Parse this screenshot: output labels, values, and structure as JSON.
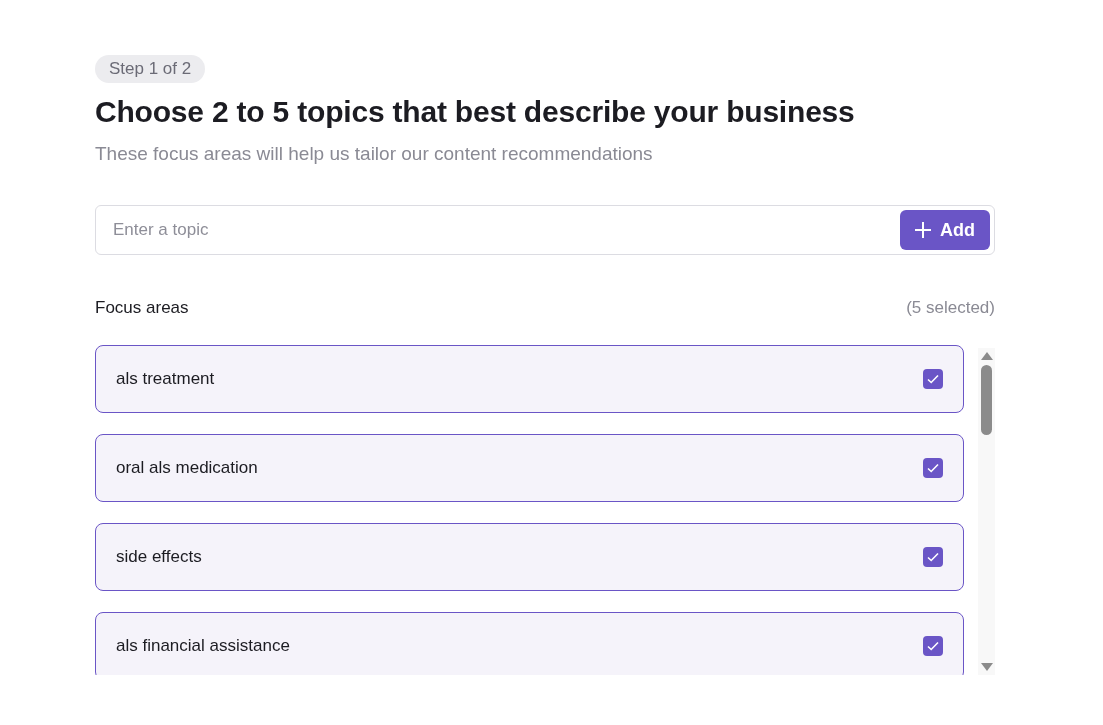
{
  "step_badge": "Step 1 of 2",
  "title": "Choose 2 to 5 topics that best describe your business",
  "subtitle": "These focus areas will help us tailor our content recommendations",
  "topic_input": {
    "placeholder": "Enter a topic"
  },
  "add_button": {
    "label": "Add"
  },
  "focus_areas": {
    "label": "Focus areas",
    "count": "(5 selected)",
    "items": [
      {
        "label": "als treatment",
        "checked": true
      },
      {
        "label": "oral als medication",
        "checked": true
      },
      {
        "label": "side effects",
        "checked": true
      },
      {
        "label": "als financial assistance",
        "checked": true
      }
    ]
  }
}
